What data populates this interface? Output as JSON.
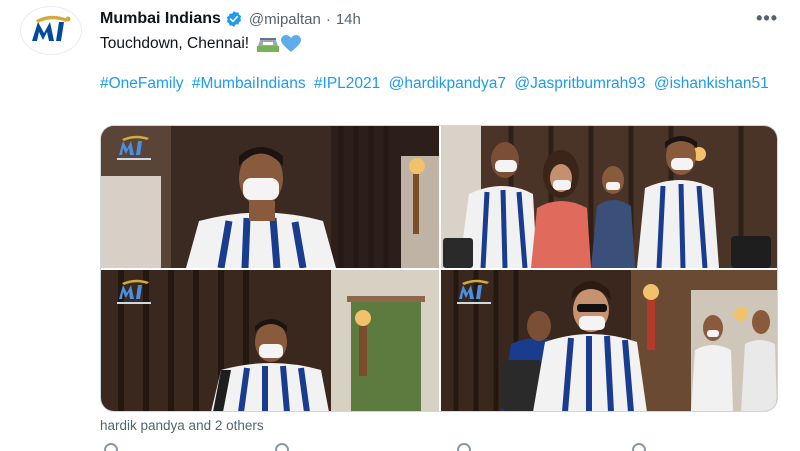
{
  "tweet": {
    "author_name": "Mumbai Indians",
    "handle": "@mipaltan",
    "separator": "·",
    "time": "14h",
    "text": "Touchdown, Chennai!",
    "hashtags": [
      "#OneFamily",
      "#MumbaiIndians",
      "#IPL2021",
      "@hardikpandya7",
      "@Jaspritbumrah93",
      "@ishankishan51"
    ],
    "more_label": "•••"
  },
  "media": {
    "photos": [
      {
        "alt": "photo-1",
        "icon": "mi-logo"
      },
      {
        "alt": "photo-2",
        "icon": "mi-logo"
      },
      {
        "alt": "photo-3",
        "icon": "mi-logo"
      },
      {
        "alt": "photo-4",
        "icon": "mi-logo"
      }
    ]
  },
  "tagged": "hardik pandya and 2 others",
  "colors": {
    "link": "#1d9bf0",
    "text": "#0f1419",
    "muted": "#536471",
    "mi_blue": "#004ba0",
    "mi_gold": "#d1ab3e"
  }
}
